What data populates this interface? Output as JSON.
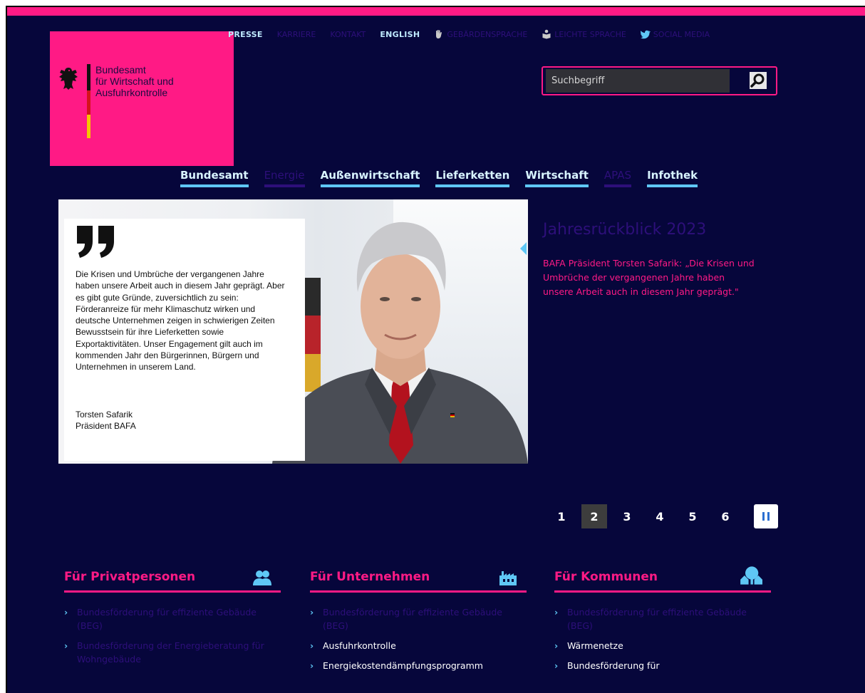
{
  "colors": {
    "background": "#06063b",
    "accent": "#ff1a85",
    "link_blue": "#5fc7f5",
    "dim_purple": "#2d0f7a"
  },
  "logo": {
    "line1": "Bundesamt",
    "line2": "für Wirtschaft und",
    "line3": "Ausfuhrkontrolle",
    "icon": "federal-eagle-icon"
  },
  "metanav": {
    "presse": "PRESSE",
    "karriere": "KARRIERE",
    "kontakt": "KONTAKT",
    "english": "ENGLISH",
    "gebaerden": "GEBÄRDENSPRACHE",
    "leichte": "LEICHTE SPRACHE",
    "social": "SOCIAL MEDIA"
  },
  "search": {
    "placeholder": "Suchbegriff",
    "icon": "search-icon"
  },
  "mainnav": {
    "bundesamt": "Bundesamt",
    "energie": "Energie",
    "aussenwirtschaft": "Außenwirtschaft",
    "lieferketten": "Lieferketten",
    "wirtschaft": "Wirtschaft",
    "apas": "APAS",
    "infothek": "Infothek"
  },
  "hero": {
    "quote": "Die Krisen und Umbrüche der vergangenen Jahre haben unsere Arbeit auch in diesem Jahr geprägt. Aber es gibt gute Gründe, zuversichtlich zu sein: Förderanreize für mehr Klimaschutz wirken und deutsche Unternehmen zeigen in schwierigen Zeiten Bewusstsein für ihre Lieferketten sowie Exportaktivitäten. Unser Engagement gilt auch im kommenden Jahr den Bürgerinnen, Bürgern und Unternehmen in unserem Land.",
    "author_name": "Torsten Safarik",
    "author_role": "Präsident BAFA"
  },
  "teaser": {
    "title": "Jahresrückblick 2023",
    "text": "BAFA Präsident Torsten Safarik: „Die Krisen und Umbrüche der vergangenen Jahre haben unsere Arbeit auch in diesem Jahr geprägt.\""
  },
  "pager": {
    "pages": [
      "1",
      "2",
      "3",
      "4",
      "5",
      "6"
    ],
    "active_page": "2",
    "pause_icon": "pause-icon"
  },
  "columns": {
    "private": {
      "title": "Für Privatpersonen",
      "icon": "people-icon",
      "items": [
        "Bundesförderung für effiziente Gebäude (BEG)",
        "Bundesförderung der Energieberatung für Wohngebäude"
      ]
    },
    "business": {
      "title": "Für Unternehmen",
      "icon": "factory-icon",
      "items": [
        "Bundesförderung für effiziente Gebäude (BEG)",
        "Ausfuhrkontrolle",
        "Energiekostendämpfungsprogramm"
      ]
    },
    "municipal": {
      "title": "Für Kommunen",
      "icon": "tree-houses-icon",
      "items": [
        "Bundesförderung für effiziente Gebäude (BEG)",
        "Wärmenetze",
        "Bundesförderung für"
      ]
    }
  }
}
